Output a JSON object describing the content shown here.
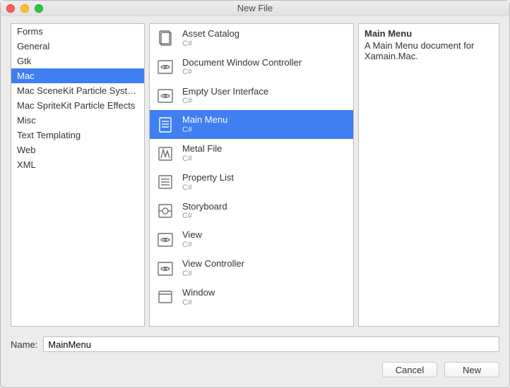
{
  "window": {
    "title": "New File"
  },
  "categories": [
    "Forms",
    "General",
    "Gtk",
    "Mac",
    "Mac SceneKit Particle Systems",
    "Mac SpriteKit Particle Effects",
    "Misc",
    "Text Templating",
    "Web",
    "XML"
  ],
  "selected_category_index": 3,
  "templates": [
    {
      "name": "Asset Catalog",
      "lang": "C#",
      "icon": "assets"
    },
    {
      "name": "Document Window Controller",
      "lang": "C#",
      "icon": "eye"
    },
    {
      "name": "Empty User Interface",
      "lang": "C#",
      "icon": "eye"
    },
    {
      "name": "Main Menu",
      "lang": "C#",
      "icon": "doc"
    },
    {
      "name": "Metal File",
      "lang": "C#",
      "icon": "metal"
    },
    {
      "name": "Property List",
      "lang": "C#",
      "icon": "list"
    },
    {
      "name": "Storyboard",
      "lang": "C#",
      "icon": "storyboard"
    },
    {
      "name": "View",
      "lang": "C#",
      "icon": "eye"
    },
    {
      "name": "View Controller",
      "lang": "C#",
      "icon": "eye"
    },
    {
      "name": "Window",
      "lang": "C#",
      "icon": "window"
    }
  ],
  "selected_template_index": 3,
  "details": {
    "title": "Main Menu",
    "description": "A Main Menu document for Xamain.Mac."
  },
  "name_field": {
    "label": "Name:",
    "value": "MainMenu"
  },
  "buttons": {
    "cancel": "Cancel",
    "new": "New"
  }
}
